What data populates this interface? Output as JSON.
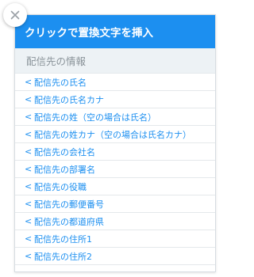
{
  "close_button_icon": "close-icon",
  "panel": {
    "title": "クリックで置換文字を挿入",
    "section_label": "配信先の情報",
    "items": [
      {
        "prefix": "<",
        "label": "配信先の氏名"
      },
      {
        "prefix": "<",
        "label": "配信先の氏名カナ"
      },
      {
        "prefix": "<",
        "label": "配信先の姓（空の場合は氏名）"
      },
      {
        "prefix": "<",
        "label": "配信先の姓カナ（空の場合は氏名カナ）"
      },
      {
        "prefix": "<",
        "label": "配信先の会社名"
      },
      {
        "prefix": "<",
        "label": "配信先の部署名"
      },
      {
        "prefix": "<",
        "label": "配信先の役職"
      },
      {
        "prefix": "<",
        "label": "配信先の郵便番号"
      },
      {
        "prefix": "<",
        "label": "配信先の都道府県"
      },
      {
        "prefix": "<",
        "label": "配信先の住所1"
      },
      {
        "prefix": "<",
        "label": "配信先の住所2"
      }
    ]
  },
  "colors": {
    "accent": "#1c8ff0",
    "section_bg": "#edf2f5",
    "section_text": "#8a9399"
  }
}
